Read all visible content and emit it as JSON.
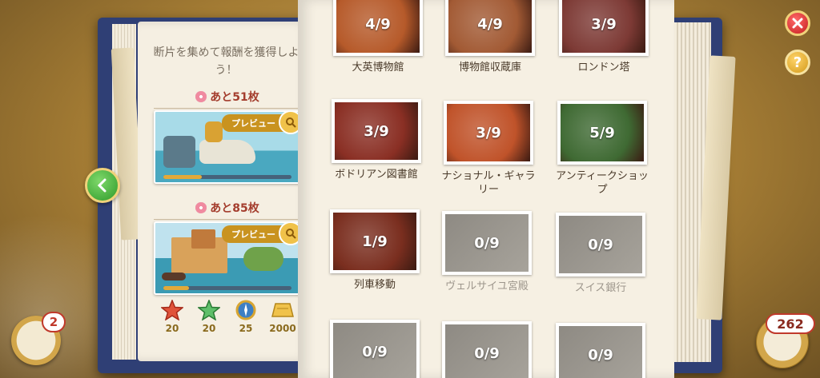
{
  "left_panel": {
    "instruction": "断片を集めて報酬を獲得しよう！",
    "rewards_a": {
      "remaining": "あと51枚",
      "preview_label": "プレビュー",
      "progress": 0.3
    },
    "rewards_b": {
      "remaining": "あと85枚",
      "preview_label": "プレビュー",
      "progress": 0.2
    },
    "item_rewards": [
      {
        "icon": "red-star-icon",
        "value": "20"
      },
      {
        "icon": "green-star-icon",
        "value": "20"
      },
      {
        "icon": "compass-icon",
        "value": "25"
      },
      {
        "icon": "gold-bar-icon",
        "value": "2000"
      }
    ]
  },
  "scenes": [
    {
      "progress": "4/9",
      "label": "大英博物館",
      "locked": false,
      "color": "#b65a2a"
    },
    {
      "progress": "4/9",
      "label": "博物館収蔵庫",
      "locked": false,
      "color": "#a25a34"
    },
    {
      "progress": "3/9",
      "label": "ロンドン塔",
      "locked": false,
      "color": "#7d3a35"
    },
    {
      "progress": "3/9",
      "label": "ボドリアン図書館",
      "locked": false,
      "color": "#8a2f24"
    },
    {
      "progress": "3/9",
      "label": "ナショナル・ギャラリー",
      "locked": false,
      "color": "#c0532a"
    },
    {
      "progress": "5/9",
      "label": "アンティークショップ",
      "locked": false,
      "color": "#3f6a33"
    },
    {
      "progress": "1/9",
      "label": "列車移動",
      "locked": false,
      "color": "#7a2e1f"
    },
    {
      "progress": "0/9",
      "label": "ヴェルサイユ宮殿",
      "locked": true,
      "color": "#9b968d"
    },
    {
      "progress": "0/9",
      "label": "スイス銀行",
      "locked": true,
      "color": "#9b968d"
    },
    {
      "progress": "0/9",
      "label": "",
      "locked": true,
      "color": "#9b968d"
    },
    {
      "progress": "0/9",
      "label": "",
      "locked": true,
      "color": "#9b968d"
    },
    {
      "progress": "0/9",
      "label": "",
      "locked": true,
      "color": "#9b968d"
    }
  ],
  "hud": {
    "notifications": "2",
    "currency": "262"
  }
}
